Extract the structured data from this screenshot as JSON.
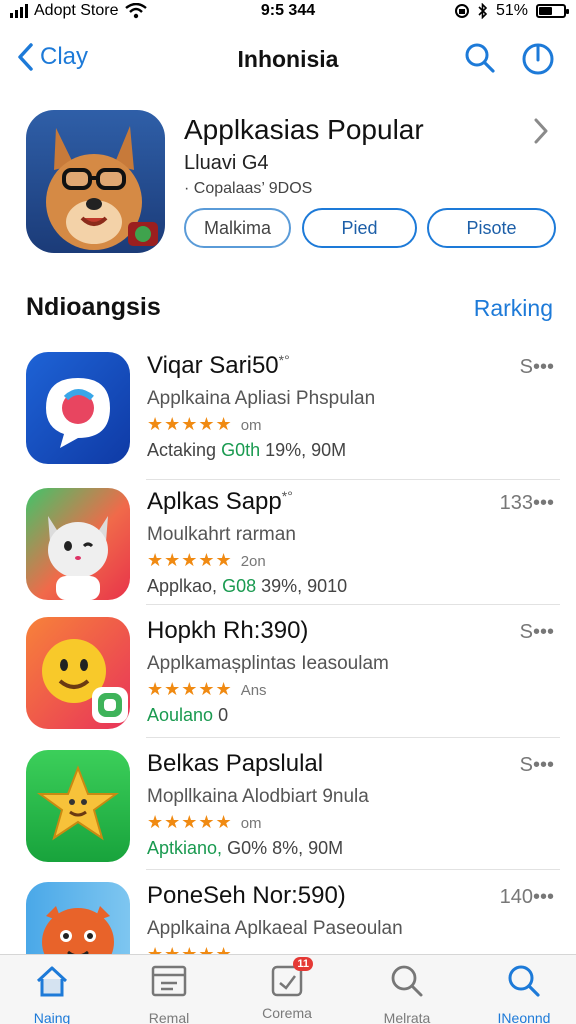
{
  "status_bar": {
    "carrier": "Adopt Store",
    "time": "9:5 344",
    "battery_percent": "51%",
    "icons": [
      "signal-bars-icon",
      "wifi-icon",
      "lock-rotation-icon",
      "bluetooth-icon",
      "battery-icon"
    ]
  },
  "nav": {
    "back_label": "Clay",
    "title": "Inhonisia",
    "icons": [
      "back-chevron-icon",
      "search-icon",
      "power-icon"
    ]
  },
  "featured": {
    "name": "Applkasias Popular",
    "line1": "Lluavi  G4",
    "line2": "· Copalaas’    9DOS",
    "buttons": [
      "Malkima",
      "Pied",
      "Pisote"
    ],
    "icon": "fox-with-glasses-icon"
  },
  "section": {
    "title": "Ndioangsis",
    "link": "Rarking"
  },
  "apps": [
    {
      "name": "Viqar Sari50",
      "suffix": "*°",
      "desc": "Applkaina Apliasi Phspulan",
      "stars": "★★★★★",
      "rating_sub": "om",
      "meta_prefix": "Actaking",
      "meta_green": "G0th",
      "meta_rest": " 19%,  90M",
      "more": "S•••",
      "icon": "chat-bubble-icon"
    },
    {
      "name": "Aplkas Sapp",
      "suffix": "*°",
      "desc": "Moulkahrt rarman",
      "stars": "★★★★★",
      "rating_sub": "2on",
      "meta_prefix": "Applkao,",
      "meta_green": "G08",
      "meta_rest": " 39%,  9010",
      "more": "133•••",
      "icon": "cartoon-cat-icon"
    },
    {
      "name": "Hopkh Rh:390)",
      "suffix": "",
      "desc": "Applkamașplintas Ieasoulam",
      "stars": "★★★★★",
      "rating_sub": "Ans",
      "meta_prefix": "",
      "meta_green": "Aoulano",
      "meta_rest": "  0",
      "more": "S•••",
      "icon": "smiley-face-icon"
    },
    {
      "name": "Belkas Papslulal",
      "suffix": "",
      "desc": "Mopllkaina Alodbiart 9nula",
      "stars": "★★★★★",
      "rating_sub": "om",
      "meta_prefix": "",
      "meta_green": "Aptkiano,",
      "meta_rest": " G0%  8%,  90M",
      "more": "S•••",
      "icon": "gold-star-icon"
    },
    {
      "name": "PoneSeh Nor:590)",
      "suffix": "",
      "desc": "Applkaina Aplkaeal Paseoulan",
      "stars": "★★★★★",
      "rating_sub": "",
      "meta_prefix": "",
      "meta_green": "",
      "meta_rest": "",
      "more": "140•••",
      "icon": "orange-character-icon"
    }
  ],
  "tabs": [
    {
      "label": "Naing",
      "icon": "home-icon",
      "active": true
    },
    {
      "label": "Remal",
      "icon": "inbox-icon",
      "active": false
    },
    {
      "label": "Corema",
      "icon": "updates-icon",
      "badge": "11",
      "active": false
    },
    {
      "label": "Melrata",
      "icon": "search-icon",
      "active": false
    },
    {
      "label": "INeonnd",
      "icon": "search-icon",
      "active": true
    }
  ],
  "colors": {
    "accent": "#1d7ad8",
    "star": "#f08a12",
    "green": "#1a9a50",
    "badge": "#e53935"
  }
}
